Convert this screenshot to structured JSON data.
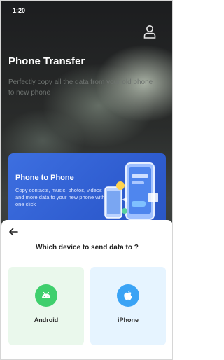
{
  "status_bar": {
    "time": "1:20"
  },
  "header": {
    "title": "Phone Transfer",
    "subtitle": "Perfectly copy all the data from your old phone to new phone",
    "profile_icon": "user-icon"
  },
  "feature_card": {
    "title": "Phone to Phone",
    "description": "Copy contacts, music, photos, videos and more data to your new phone with one click",
    "accent_color": "#2f5dd0"
  },
  "device_sheet": {
    "back_icon": "arrow-left-icon",
    "question": "Which device to send data to ?",
    "options": [
      {
        "label": "Android",
        "icon": "android-icon",
        "color": "#3fcf6d"
      },
      {
        "label": "iPhone",
        "icon": "apple-icon",
        "color": "#3aa3f5"
      }
    ]
  }
}
